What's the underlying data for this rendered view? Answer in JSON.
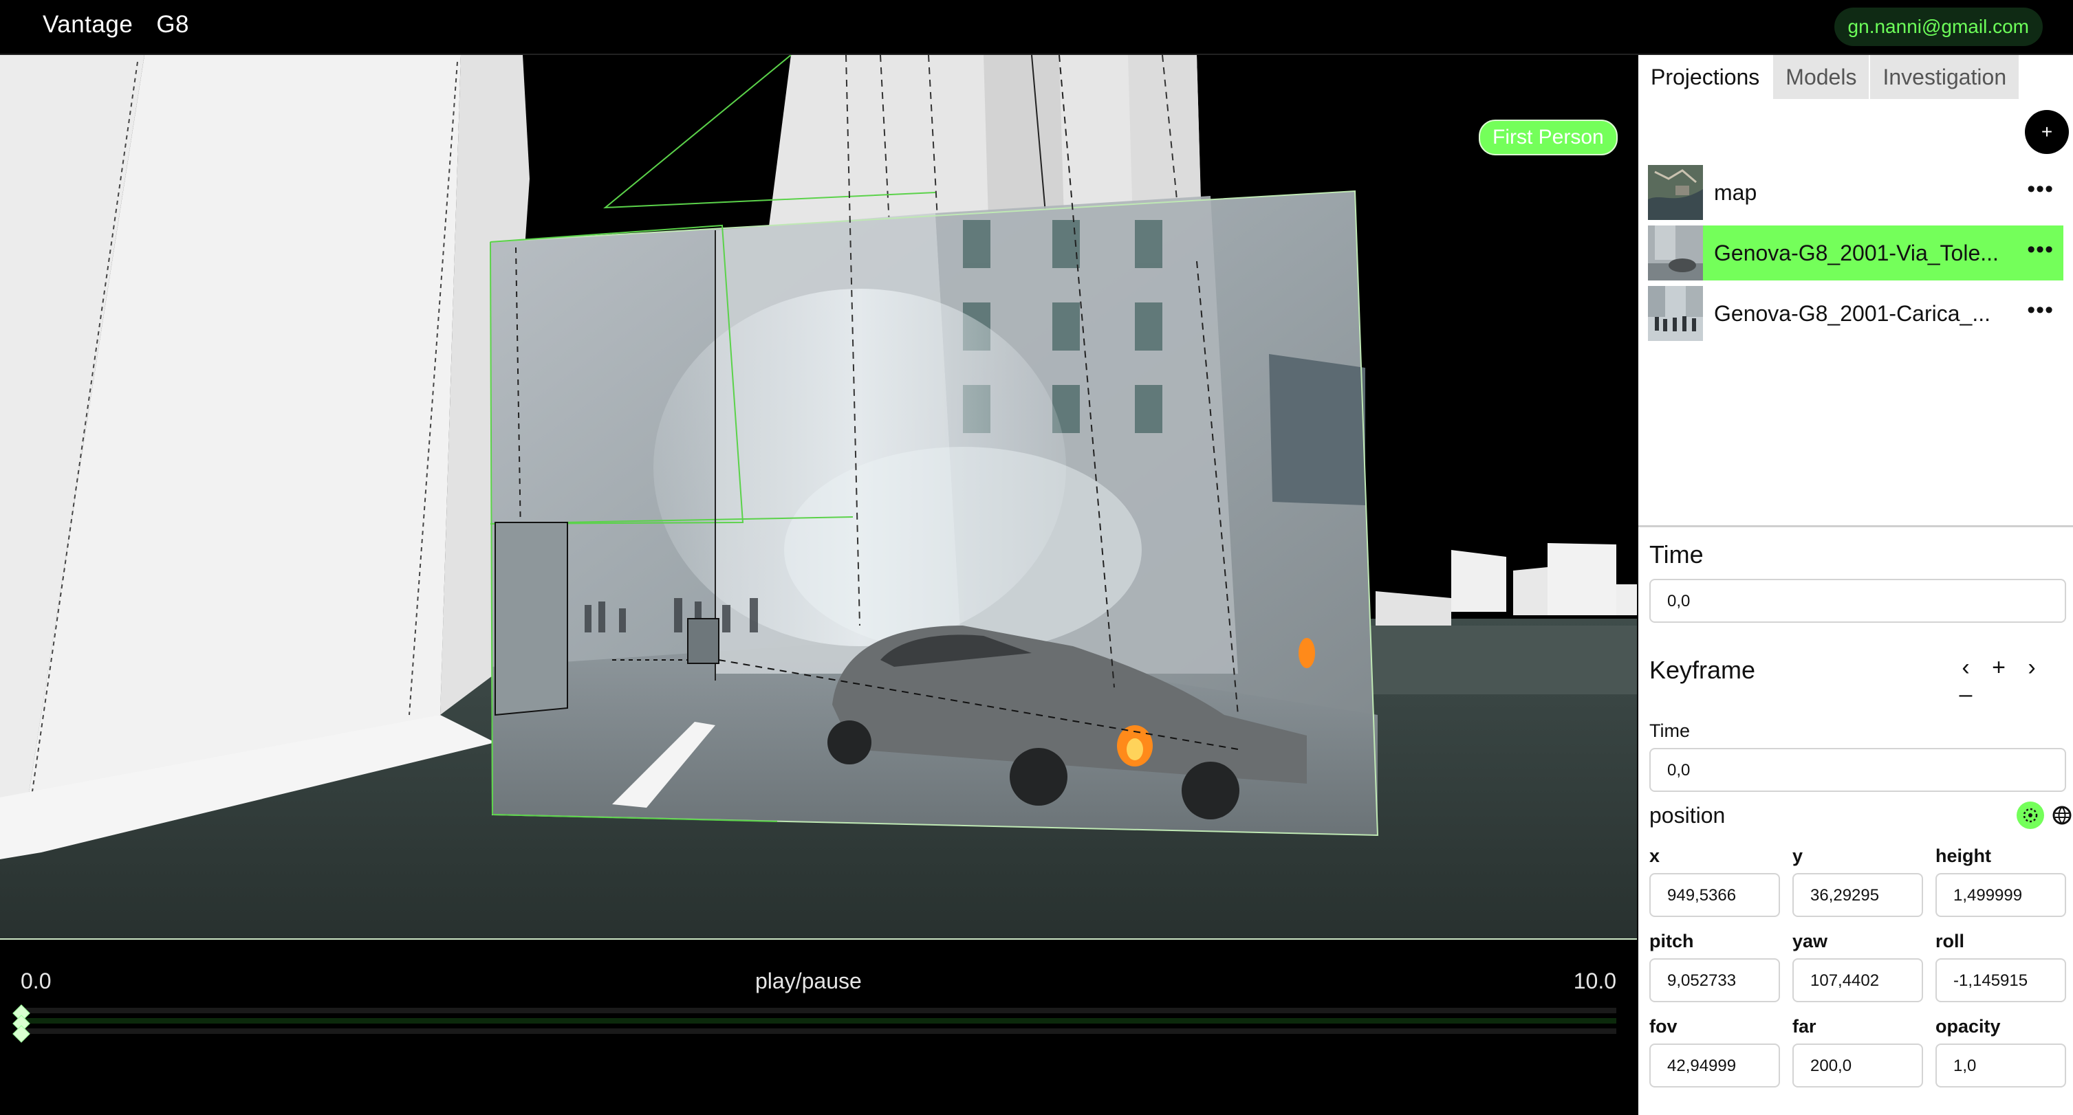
{
  "app": {
    "name": "Vantage",
    "project": "G8",
    "user_email": "gn.nanni@gmail.com"
  },
  "viewport": {
    "mode_label": "First Person"
  },
  "timeline": {
    "start": "0.0",
    "play_label": "play/pause",
    "end": "10.0"
  },
  "panel": {
    "tabs": [
      "Projections",
      "Models",
      "Investigation"
    ],
    "active_tab": "Projections",
    "add_label": "+",
    "projections": [
      {
        "name": "map",
        "selected": false
      },
      {
        "name": "Genova-G8_2001-Via_Tole...",
        "selected": true
      },
      {
        "name": "Genova-G8_2001-Carica_...",
        "selected": false
      }
    ],
    "more_label": "•••",
    "time_section": {
      "title": "Time",
      "value": "0,0"
    },
    "keyframe": {
      "title": "Keyframe",
      "prev": "‹",
      "add": "+",
      "next": "›",
      "remove": "–",
      "time_label": "Time",
      "time_value": "0,0",
      "position_label": "position",
      "fields": {
        "x": {
          "label": "x",
          "value": "949,5366"
        },
        "y": {
          "label": "y",
          "value": "36,29295"
        },
        "height": {
          "label": "height",
          "value": "1,499999"
        },
        "pitch": {
          "label": "pitch",
          "value": "9,052733"
        },
        "yaw": {
          "label": "yaw",
          "value": "107,4402"
        },
        "roll": {
          "label": "roll",
          "value": "-1,145915"
        },
        "fov": {
          "label": "fov",
          "value": "42,94999"
        },
        "far": {
          "label": "far",
          "value": "200,0"
        },
        "opacity": {
          "label": "opacity",
          "value": "1,0"
        }
      }
    }
  },
  "colors": {
    "accent": "#74ff5a",
    "badge_bg": "#0f2a14",
    "panel_bg": "#ffffff"
  }
}
